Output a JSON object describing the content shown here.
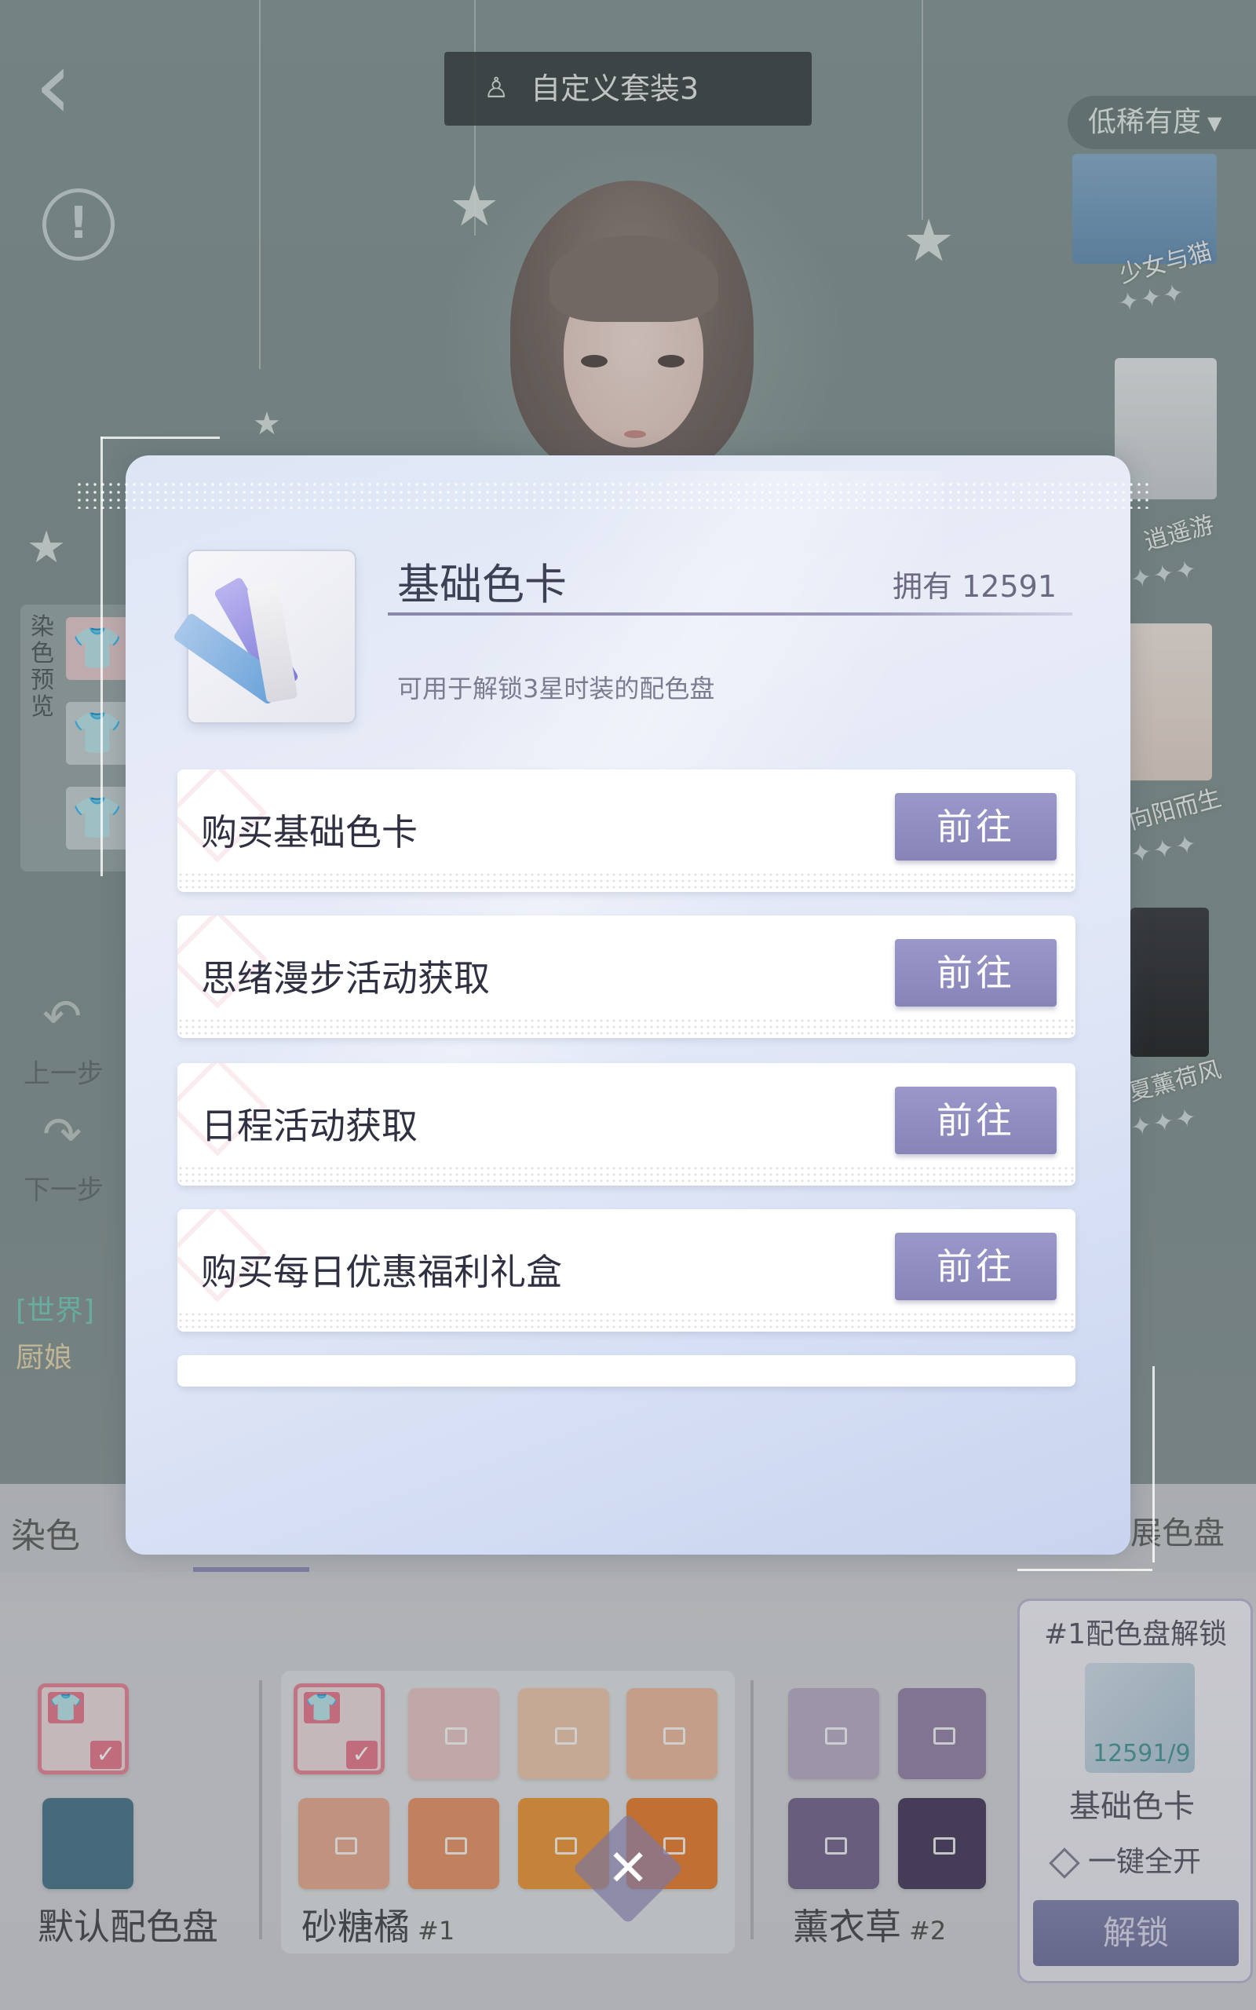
{
  "header": {
    "outfit_title": "自定义套装3",
    "rarity_filter": "低稀有度"
  },
  "outfits": [
    {
      "name": "少女与猫",
      "stars": "✦✦✦"
    },
    {
      "name": "逍遥游",
      "stars": "✦✦✦"
    },
    {
      "name": "向阳而生",
      "stars": "✦✦✦"
    },
    {
      "name": "夏薰荷风",
      "stars": "✦✦✦"
    }
  ],
  "left_panel": {
    "dye_preview_label": "染色预览",
    "undo_label": "上一步",
    "redo_label": "下一步"
  },
  "chat": {
    "channel": "[世界]",
    "user": "厨娘"
  },
  "bottom": {
    "tab_dye": "染色",
    "tab_expand": "扩展色盘",
    "palettes": [
      {
        "name": "默认配色盘",
        "num": ""
      },
      {
        "name": "砂糖橘",
        "num": "#1"
      },
      {
        "name": "薰衣草",
        "num": "#2"
      }
    ],
    "unlock": {
      "title": "#1配色盘解锁",
      "count": "12591/9",
      "card_name": "基础色卡",
      "unlock_all": "一键全开",
      "unlock_button": "解锁"
    },
    "swatch_colors": {
      "default_blue": "#3f6d84",
      "orange_light": "#f0b896",
      "orange_mid": "#e9a487",
      "orange_deep": "#e98d5e",
      "orange_bright": "#ee8f27",
      "orange_dark": "#e9741f",
      "lavender_light": "#b9a7c5",
      "lavender_mid": "#8f7ba3",
      "lavender_deep": "#6e5a87",
      "lavender_dark": "#3d2f52"
    }
  },
  "modal": {
    "item_name": "基础色卡",
    "owned_label": "拥有",
    "owned_count": "12591",
    "description": "可用于解锁3星时装的配色盘",
    "sources": [
      {
        "label": "购买基础色卡",
        "button": "前往"
      },
      {
        "label": "思绪漫步活动获取",
        "button": "前往"
      },
      {
        "label": "日程活动获取",
        "button": "前往"
      },
      {
        "label": "购买每日优惠福利礼盒",
        "button": "前往"
      }
    ],
    "close_icon": "close-icon",
    "accent_color": "#8784b8"
  }
}
